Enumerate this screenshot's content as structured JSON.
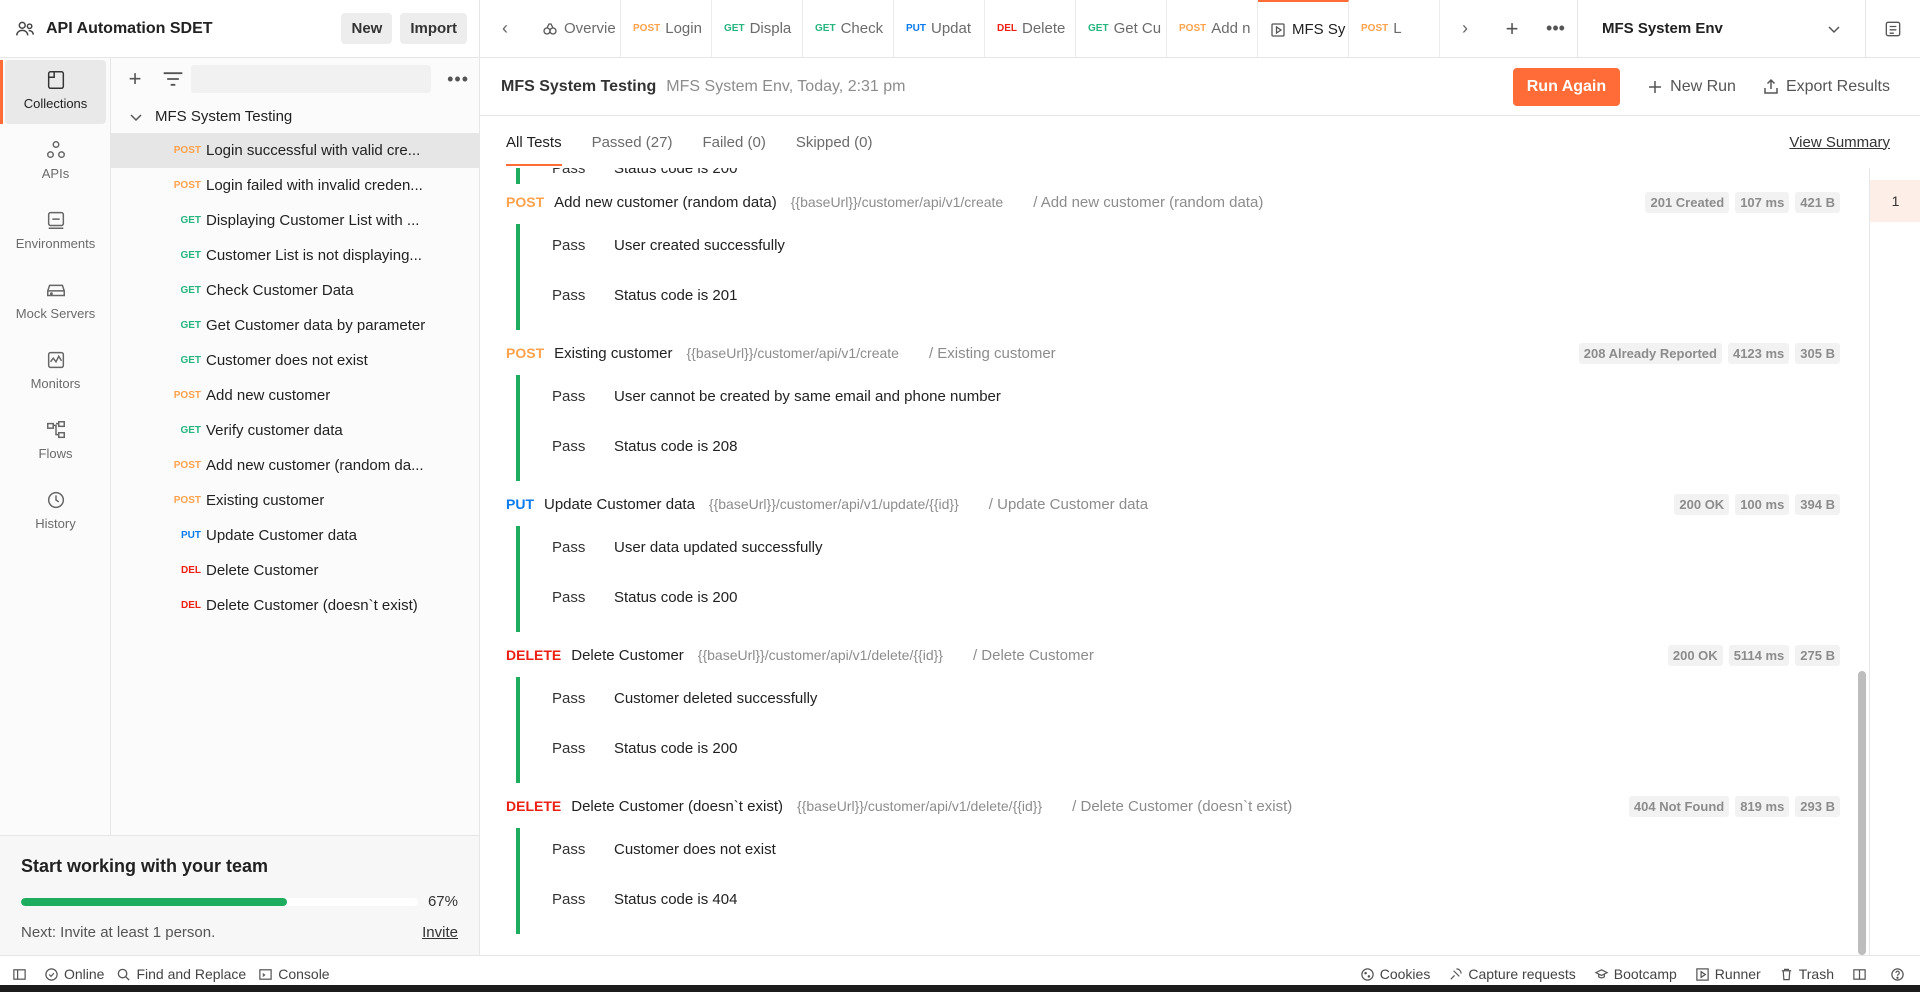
{
  "workspace": {
    "title": "API Automation SDET",
    "new_label": "New",
    "import_label": "Import"
  },
  "rail": {
    "items": [
      {
        "label": "Collections",
        "icon": "collections-icon",
        "active": true
      },
      {
        "label": "APIs",
        "icon": "apis-icon"
      },
      {
        "label": "Environments",
        "icon": "environments-icon"
      },
      {
        "label": "Mock Servers",
        "icon": "mock-servers-icon"
      },
      {
        "label": "Monitors",
        "icon": "monitors-icon"
      },
      {
        "label": "Flows",
        "icon": "flows-icon"
      },
      {
        "label": "History",
        "icon": "history-icon"
      }
    ]
  },
  "tree": {
    "collection": "MFS System Testing",
    "items": [
      {
        "method": "POST",
        "name": "Login successful with valid cre...",
        "selected": true
      },
      {
        "method": "POST",
        "name": "Login failed with invalid creden..."
      },
      {
        "method": "GET",
        "name": "Displaying Customer List with ..."
      },
      {
        "method": "GET",
        "name": "Customer List is not displaying..."
      },
      {
        "method": "GET",
        "name": "Check Customer Data"
      },
      {
        "method": "GET",
        "name": "Get Customer data by parameter"
      },
      {
        "method": "GET",
        "name": "Customer does not exist"
      },
      {
        "method": "POST",
        "name": "Add new customer"
      },
      {
        "method": "GET",
        "name": "Verify customer data"
      },
      {
        "method": "POST",
        "name": "Add new customer (random da..."
      },
      {
        "method": "POST",
        "name": "Existing customer"
      },
      {
        "method": "PUT",
        "name": "Update Customer data"
      },
      {
        "method": "DEL",
        "name": "Delete Customer"
      },
      {
        "method": "DEL",
        "name": "Delete Customer (doesn`t exist)"
      }
    ]
  },
  "promo": {
    "title": "Start working with your team",
    "progress_percent": 67,
    "progress_label": "67%",
    "next_text": "Next: Invite at least 1 person.",
    "invite_label": "Invite"
  },
  "tabs": [
    {
      "method": "",
      "label": "Overvie",
      "icon": "overview-icon"
    },
    {
      "method": "POST",
      "label": "Login"
    },
    {
      "method": "GET",
      "label": "Displa"
    },
    {
      "method": "GET",
      "label": "Check"
    },
    {
      "method": "PUT",
      "label": "Updat"
    },
    {
      "method": "DEL",
      "label": "Delete"
    },
    {
      "method": "GET",
      "label": "Get Cu"
    },
    {
      "method": "POST",
      "label": "Add n"
    },
    {
      "method": "",
      "label": "MFS Sy",
      "icon": "runner-tab-icon",
      "active": true
    },
    {
      "method": "POST",
      "label": "L"
    }
  ],
  "environment": {
    "selected": "MFS System Env"
  },
  "run": {
    "title": "MFS System Testing",
    "meta": "MFS System Env, Today, 2:31 pm",
    "run_again": "Run Again",
    "new_run": "New Run",
    "export_results": "Export Results"
  },
  "filters": {
    "all": "All Tests",
    "passed": "Passed (27)",
    "failed": "Failed (0)",
    "skipped": "Skipped (0)",
    "view_summary": "View Summary"
  },
  "partial_test": {
    "status": "Pass",
    "name": "Status code is 200"
  },
  "results": [
    {
      "method": "POST",
      "name": "Add new customer (random data)",
      "url": "{{baseUrl}}/customer/api/v1/create",
      "path": "/ Add new customer (random data)",
      "status": "201 Created",
      "time": "107 ms",
      "size": "421 B",
      "tests": [
        {
          "status": "Pass",
          "name": "User created successfully"
        },
        {
          "status": "Pass",
          "name": "Status code is 201"
        }
      ]
    },
    {
      "method": "POST",
      "name": "Existing customer",
      "url": "{{baseUrl}}/customer/api/v1/create",
      "path": "/ Existing customer",
      "status": "208 Already Reported",
      "time": "4123 ms",
      "size": "305 B",
      "tests": [
        {
          "status": "Pass",
          "name": "User cannot be created by same email and phone number"
        },
        {
          "status": "Pass",
          "name": "Status code is 208"
        }
      ]
    },
    {
      "method": "PUT",
      "name": "Update Customer data",
      "url": "{{baseUrl}}/customer/api/v1/update/{{id}}",
      "path": "/ Update Customer data",
      "status": "200 OK",
      "time": "100 ms",
      "size": "394 B",
      "tests": [
        {
          "status": "Pass",
          "name": "User data updated successfully"
        },
        {
          "status": "Pass",
          "name": "Status code is 200"
        }
      ]
    },
    {
      "method": "DELETE",
      "name": "Delete Customer",
      "url": "{{baseUrl}}/customer/api/v1/delete/{{id}}",
      "path": "/ Delete Customer",
      "status": "200 OK",
      "time": "5114 ms",
      "size": "275 B",
      "tests": [
        {
          "status": "Pass",
          "name": "Customer deleted successfully"
        },
        {
          "status": "Pass",
          "name": "Status code is 200"
        }
      ]
    },
    {
      "method": "DELETE",
      "name": "Delete Customer (doesn`t exist)",
      "url": "{{baseUrl}}/customer/api/v1/delete/{{id}}",
      "path": "/ Delete Customer (doesn`t exist)",
      "status": "404 Not Found",
      "time": "819 ms",
      "size": "293 B",
      "tests": [
        {
          "status": "Pass",
          "name": "Customer does not exist"
        },
        {
          "status": "Pass",
          "name": "Status code is 404"
        }
      ]
    }
  ],
  "minimap": {
    "marker": "1"
  },
  "statusbar": {
    "online": "Online",
    "find_replace": "Find and Replace",
    "console": "Console",
    "cookies": "Cookies",
    "capture": "Capture requests",
    "bootcamp": "Bootcamp",
    "runner": "Runner",
    "trash": "Trash"
  },
  "colors": {
    "accent": "#ff6c37",
    "post": "#ffa24b",
    "get": "#26b47f",
    "put": "#097bed",
    "delete": "#eb2013",
    "pass_bar": "#1ead5f"
  }
}
